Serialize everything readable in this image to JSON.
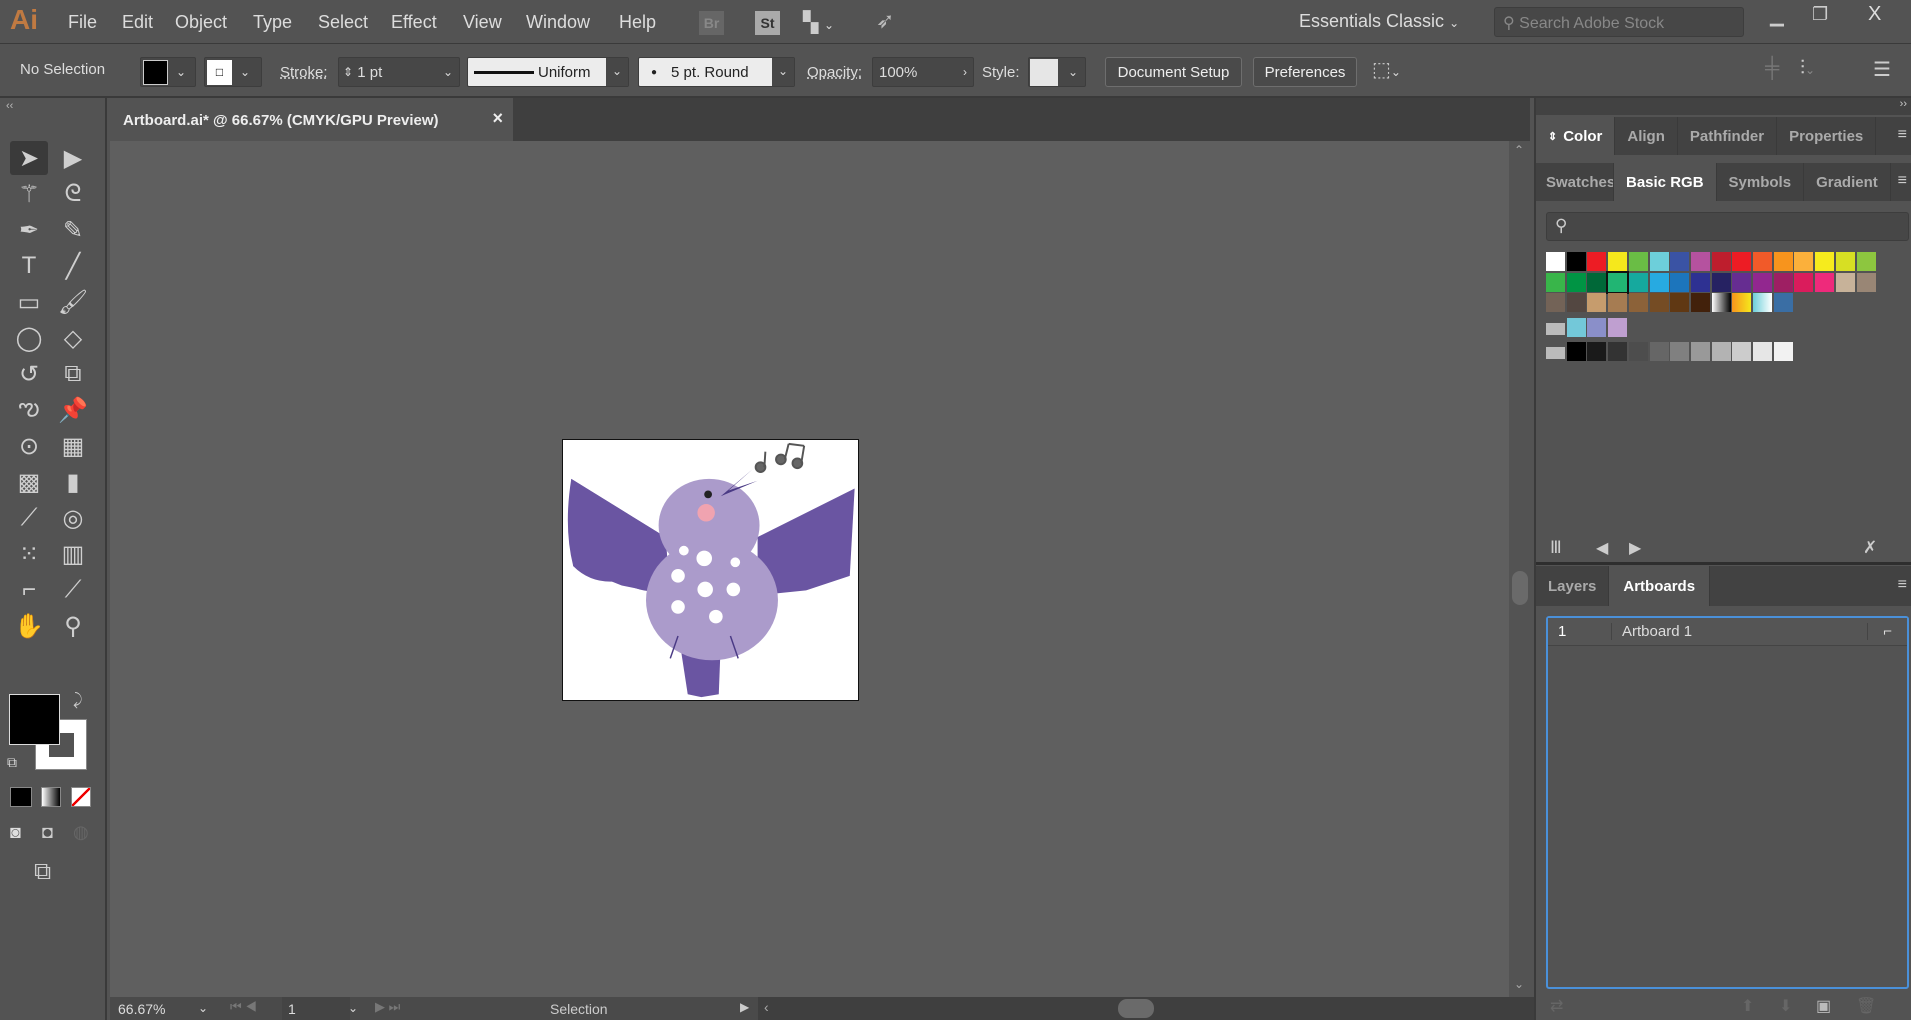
{
  "app": {
    "logo": "Ai",
    "menu": [
      "File",
      "Edit",
      "Object",
      "Type",
      "Select",
      "Effect",
      "View",
      "Window",
      "Help"
    ],
    "bridge": "Br",
    "stock": "St",
    "workspace": "Essentials Classic",
    "search_placeholder": "Search Adobe Stock",
    "window_controls": [
      "minimize-icon",
      "restore-icon",
      "close-icon"
    ]
  },
  "control": {
    "selection": "No Selection",
    "stroke_label": "Stroke:",
    "stroke_value": "1 pt",
    "profile": "Uniform",
    "brush": "5 pt. Round",
    "opacity_label": "Opacity:",
    "opacity_value": "100%",
    "style_label": "Style:",
    "document_setup": "Document Setup",
    "preferences": "Preferences"
  },
  "document": {
    "tab_title": "Artboard.ai* @ 66.67% (CMYK/GPU Preview)",
    "close": "×"
  },
  "tools": [
    [
      "selection-tool-icon",
      "➤"
    ],
    [
      "direct-selection-tool-icon",
      "▶"
    ],
    [
      "magic-wand-icon",
      "⚚"
    ],
    [
      "lasso-icon",
      "ᘓ"
    ],
    [
      "pen-tool-icon",
      "✒"
    ],
    [
      "curvature-tool-icon",
      "✎"
    ],
    [
      "type-tool-icon",
      "T"
    ],
    [
      "line-tool-icon",
      "╱"
    ],
    [
      "rectangle-tool-icon",
      "▭"
    ],
    [
      "paintbrush-icon",
      "🖌"
    ],
    [
      "shaper-tool-icon",
      "◯"
    ],
    [
      "eraser-icon",
      "◇"
    ],
    [
      "rotate-tool-icon",
      "↺"
    ],
    [
      "scale-tool-icon",
      "⧉"
    ],
    [
      "warp-tool-icon",
      "ఌ"
    ],
    [
      "puppet-warp-icon",
      "📌"
    ],
    [
      "shape-builder-icon",
      "⊙"
    ],
    [
      "perspective-grid-icon",
      "▦"
    ],
    [
      "mesh-tool-icon",
      "▩"
    ],
    [
      "gradient-tool-icon",
      "▮"
    ],
    [
      "eyedropper-icon",
      "⟋"
    ],
    [
      "blend-tool-icon",
      "◎"
    ],
    [
      "symbol-sprayer-icon",
      "⁙"
    ],
    [
      "column-graph-icon",
      "▥"
    ],
    [
      "artboard-tool-icon",
      "⌐"
    ],
    [
      "slice-tool-icon",
      "⟋"
    ],
    [
      "hand-tool-icon",
      "✋"
    ],
    [
      "zoom-tool-icon",
      "⚲"
    ]
  ],
  "status": {
    "zoom": "66.67%",
    "artboard_num": "1",
    "mode": "Selection"
  },
  "panels": {
    "top_tabs": [
      "Color",
      "Align",
      "Pathfinder",
      "Properties"
    ],
    "swatch_tabs": [
      "Swatches",
      "Basic RGB",
      "Symbols",
      "Gradient"
    ],
    "swatch_rows": [
      [
        "#ffffff",
        "#000000",
        "#ed1c24",
        "#f5e81c",
        "#6abd45",
        "#6dcfda",
        "#3a53a4",
        "#b5529f",
        "#be1e2d",
        "#ed1c24",
        "#f15a29",
        "#f7941d",
        "#fbb03b",
        "#f6eb1d",
        "#d7df23",
        "#8dc63f"
      ],
      [
        "#39b54a",
        "#009444",
        "#006838",
        "#21b573",
        "#16a99e",
        "#27aae1",
        "#1c75bc",
        "#2e3192",
        "#262262",
        "#662d91",
        "#92278f",
        "#9e1f63",
        "#da1c5c",
        "#ee2a7b",
        "#c7b299",
        "#998675"
      ],
      [
        "#736357",
        "#534741",
        "#c69c6d",
        "#a67c52",
        "#8c6239",
        "#754c24",
        "#603813",
        "#42210b",
        "linear-gradient(90deg,#fff,#000)",
        "linear-gradient(90deg,#f7941d,#f5e81c)",
        "linear-gradient(90deg,#6dcfda,#fff)",
        "#3a6ea4"
      ]
    ],
    "group_rows": [
      [
        "#73c8d9",
        "#8a8fc9",
        "#bf9fd0"
      ],
      [
        "#000000",
        "#1a1a1a",
        "#333333",
        "#4d4d4d",
        "#666666",
        "#808080",
        "#999999",
        "#b3b3b3",
        "#cccccc",
        "#e6e6e6",
        "#f2f2f2"
      ]
    ],
    "selected_swatch": "#21b573",
    "bottom_tabs": [
      "Layers",
      "Artboards"
    ],
    "artboards": [
      {
        "num": "1",
        "name": "Artboard 1"
      }
    ]
  },
  "colors": {
    "accent": "#4a90d9",
    "bird_body": "#ab9bcb",
    "bird_wing": "#6a55a2"
  }
}
